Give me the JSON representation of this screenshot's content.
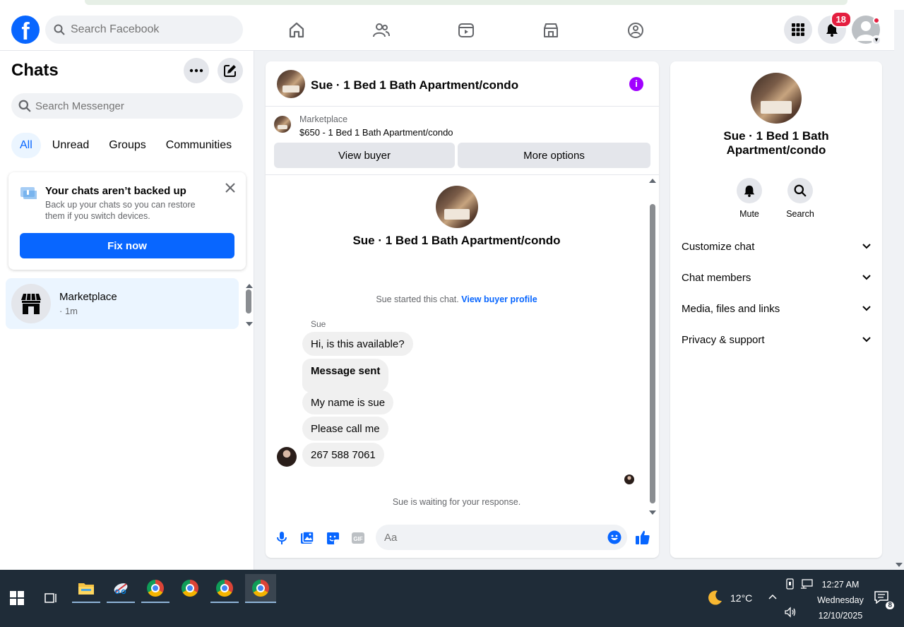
{
  "topnav": {
    "search_placeholder": "Search Facebook",
    "notifications_count": "18",
    "brand_color": "#0866ff"
  },
  "sidebar": {
    "title": "Chats",
    "search_placeholder": "Search Messenger",
    "filters": [
      "All",
      "Unread",
      "Groups",
      "Communities"
    ],
    "active_filter": "All",
    "backup": {
      "title": "Your chats aren’t backed up",
      "description": "Back up your chats so you can restore them if you switch devices.",
      "button": "Fix now"
    },
    "chat_item": {
      "name": "Marketplace",
      "time": "· 1m"
    }
  },
  "conversation": {
    "title": "Sue · 1 Bed 1 Bath Apartment/condo",
    "marketplace_label": "Marketplace",
    "listing": "$650 - 1 Bed 1 Bath Apartment/condo",
    "view_buyer": "View buyer",
    "more_options": "More options",
    "started_text": "Sue started this chat.",
    "view_buyer_profile": "View buyer profile",
    "sender": "Sue",
    "messages": [
      "Hi, is this available?",
      "Message sent",
      "My name is sue",
      "Please call me",
      "267 588 7061"
    ],
    "waiting": "Sue is waiting for your response.",
    "composer_placeholder": "Aa"
  },
  "info_panel": {
    "title": "Sue · 1 Bed 1 Bath Apartment/condo",
    "actions": [
      "Mute",
      "Search"
    ],
    "sections": [
      "Customize chat",
      "Chat members",
      "Media, files and links",
      "Privacy & support"
    ]
  },
  "taskbar": {
    "temperature": "12°C",
    "time": "12:27 AM",
    "day": "Wednesday",
    "date": "12/10/2025",
    "notifications": "8"
  }
}
